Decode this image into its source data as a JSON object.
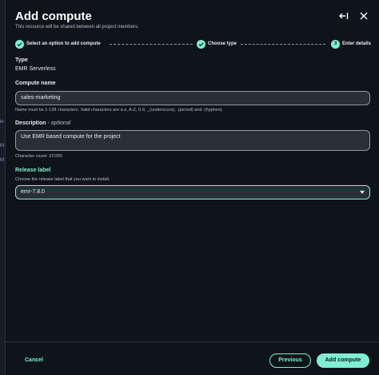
{
  "background": {
    "fragments": [
      "le",
      "M",
      "M"
    ]
  },
  "header": {
    "title": "Add compute",
    "subtitle": "This resource will be shared between all project members.",
    "collapse_icon": "collapse-left-icon",
    "close_icon": "close-icon"
  },
  "steps": [
    {
      "label": "Select an option to add compute",
      "state": "complete"
    },
    {
      "label": "Choose type",
      "state": "complete"
    },
    {
      "label": "Enter details",
      "state": "current",
      "number": "3"
    }
  ],
  "type_section": {
    "label": "Type",
    "value": "EMR Serverless"
  },
  "compute_name": {
    "label": "Compute name",
    "value": "sales-marketing",
    "hint": "Name must be 1-128 characters. Valid characters are a-z, A-Z, 0-9, _(underscore), .(period) and -(hyphen)."
  },
  "description": {
    "label": "Description",
    "optional": "- optional",
    "value": "Use EMR based compute for the project",
    "char_count": "Character count: 37/255"
  },
  "release_label": {
    "label": "Release label",
    "hint": "Choose the release label that you want to install.",
    "selected": "emr-7.8.0"
  },
  "footer": {
    "cancel": "Cancel",
    "previous": "Previous",
    "submit": "Add compute"
  },
  "colors": {
    "accent": "#7ef0cf",
    "background": "#0f141a",
    "input_bg": "#2a2f37"
  }
}
